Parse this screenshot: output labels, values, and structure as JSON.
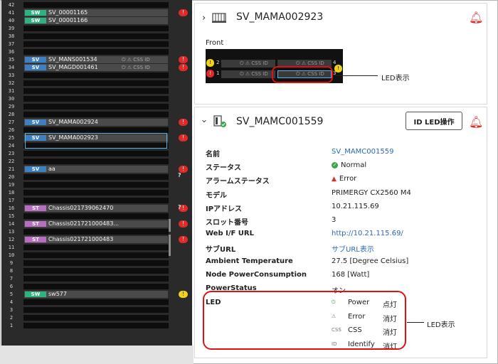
{
  "rack": {
    "rows": [
      {
        "n": "42"
      },
      {
        "n": "41",
        "badge": "SW",
        "name": "SV_00001165",
        "alarm": "red"
      },
      {
        "n": "40",
        "badge": "SW",
        "name": "SV_00001166"
      },
      {
        "n": "39"
      },
      {
        "n": "38"
      },
      {
        "n": "37"
      },
      {
        "n": "36"
      },
      {
        "n": "35",
        "badge": "SV",
        "name": "SV_MANS001534",
        "icons": "⏻ ⚠ CSS ID",
        "alarm": "red"
      },
      {
        "n": "34",
        "badge": "SV",
        "name": "SV_MAGD001461",
        "icons": "⏻ ⚠ CSS ID",
        "alarm": "red"
      },
      {
        "n": "33"
      },
      {
        "n": "32"
      },
      {
        "n": "31"
      },
      {
        "n": "30"
      },
      {
        "n": "29"
      },
      {
        "n": "28"
      },
      {
        "n": "27",
        "badge": "SV",
        "name": "SV_MAMA002924",
        "alarm": "red"
      },
      {
        "n": "26"
      },
      {
        "n": "25",
        "badge": "SV",
        "name": "SV_MAMA002923",
        "alarm": "red"
      },
      {
        "n": "24"
      },
      {
        "n": "23"
      },
      {
        "n": "22"
      },
      {
        "n": "21",
        "badge": "SV",
        "name": "aa",
        "alarm": "red"
      },
      {
        "n": "20"
      },
      {
        "n": "19"
      },
      {
        "n": "18"
      },
      {
        "n": "17"
      },
      {
        "n": "16",
        "badge": "ST",
        "name": "Chassis021739062470",
        "alarm": "red"
      },
      {
        "n": "15"
      },
      {
        "n": "14",
        "badge": "ST",
        "name": "Chassis02172100048З...",
        "alarm": "red"
      },
      {
        "n": "13"
      },
      {
        "n": "12",
        "badge": "ST",
        "name": "Chassis021721000483",
        "alarm": "red"
      },
      {
        "n": "11"
      },
      {
        "n": "10"
      },
      {
        "n": "9"
      },
      {
        "n": "8"
      },
      {
        "n": "7"
      },
      {
        "n": "6"
      },
      {
        "n": "5",
        "badge": "SW",
        "name": "sw577",
        "alarm": "yellow"
      },
      {
        "n": "4"
      },
      {
        "n": "3"
      },
      {
        "n": "2"
      },
      {
        "n": "1"
      }
    ],
    "extra_unknown": "?"
  },
  "top_panel": {
    "title": "SV_MAMA002923",
    "front_label": "Front",
    "slot_left_top_num": "2",
    "slot_left_bot_num": "1",
    "slot_right_top_num": "4",
    "slot_right_bot_num": "3",
    "mini_icons": "⏻ ⚠ CSS ID",
    "callout": "LED表示"
  },
  "detail_panel": {
    "title": "SV_MAMC001559",
    "id_led_button": "ID LED操作",
    "fields": [
      {
        "label": "名前",
        "value": "SV_MAMC001559",
        "kind": "link"
      },
      {
        "label": "ステータス",
        "value": "Normal",
        "kind": "status"
      },
      {
        "label": "アラームステータス",
        "value": "Error",
        "kind": "error"
      },
      {
        "label": "モデル",
        "value": "PRIMERGY CX2560 M4",
        "kind": "text"
      },
      {
        "label": "IPアドレス",
        "value": "10.21.115.69",
        "kind": "text"
      },
      {
        "label": "スロット番号",
        "value": "3",
        "kind": "text"
      },
      {
        "label": "Web I/F URL",
        "value": "http://10.21.115.69/",
        "kind": "link"
      },
      {
        "label": "サブURL",
        "value": "サブURL表示",
        "kind": "link"
      },
      {
        "label": "Ambient Temperature",
        "value": "27.5 [Degree Celsius]",
        "kind": "text"
      },
      {
        "label": "Node PowerConsumption",
        "value": "168 [Watt]",
        "kind": "text"
      },
      {
        "label": "PowerStatus",
        "value": "オン",
        "kind": "text"
      }
    ],
    "led_label": "LED",
    "leds": [
      {
        "icon": "⏻",
        "name": "Power",
        "state": "点灯"
      },
      {
        "icon": "⚠",
        "name": "Error",
        "state": "消灯"
      },
      {
        "icon": "CSS",
        "name": "CSS",
        "state": "消灯"
      },
      {
        "icon": "ID",
        "name": "Identify",
        "state": "消灯"
      }
    ],
    "callout": "LED表示"
  },
  "colors": {
    "sw": "#2fb37e",
    "sv": "#3e7fc4",
    "st": "#b86cc2",
    "alarm_red": "#e32a2a",
    "alarm_yellow": "#f0d21a",
    "link": "#2a6ab8"
  }
}
